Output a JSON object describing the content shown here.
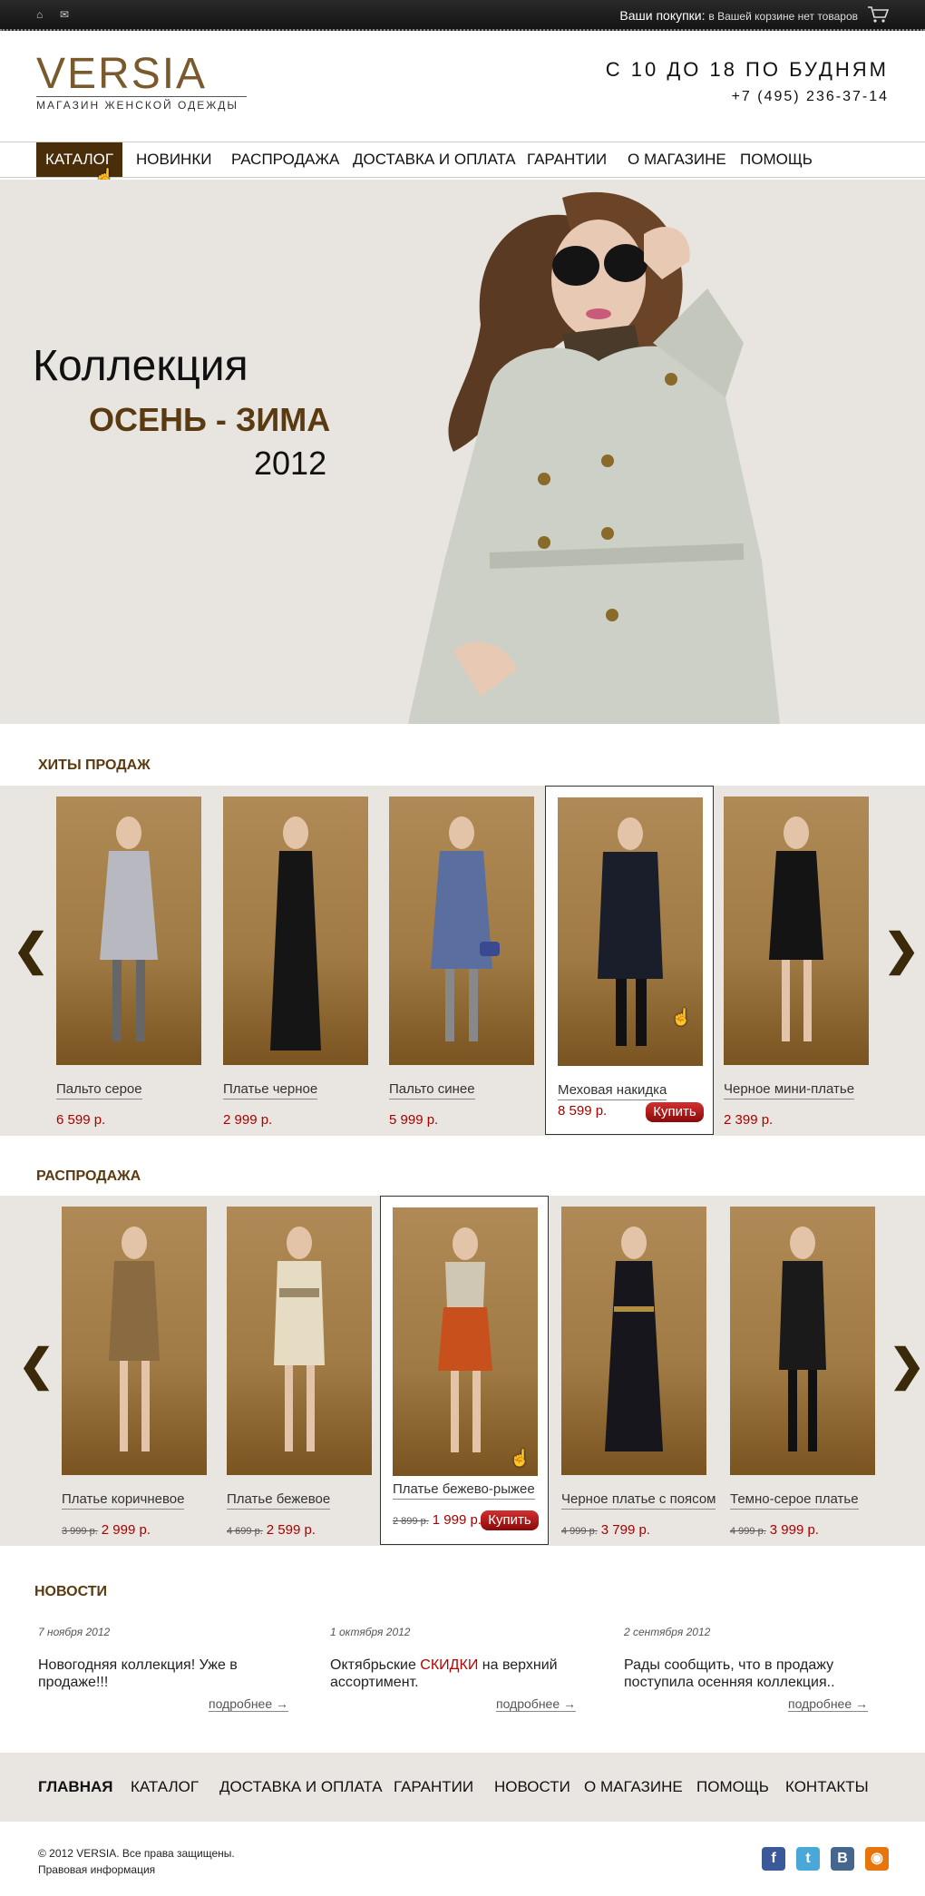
{
  "topbar": {
    "cart_label": "Ваши покупки:",
    "cart_status": "в Вашей корзине нет товаров",
    "icons": [
      "home-icon",
      "mail-icon",
      "cart-icon"
    ]
  },
  "header": {
    "logo": "VERSIA",
    "logo_sub": "МАГАЗИН ЖЕНСКОЙ ОДЕЖДЫ",
    "hours": "С 10 ДО 18 ПО БУДНЯМ",
    "phone": "+7 (495) 236-37-14"
  },
  "nav": {
    "items": [
      {
        "label": "КАТАЛОГ",
        "active": true
      },
      {
        "label": "НОВИНКИ"
      },
      {
        "label": "РАСПРОДАЖА"
      },
      {
        "label": "ДОСТАВКА И ОПЛАТА"
      },
      {
        "label": "ГАРАНТИИ"
      },
      {
        "label": "О МАГАЗИНЕ"
      },
      {
        "label": "ПОМОЩЬ"
      }
    ],
    "active_color": "#4a2e0a"
  },
  "hero": {
    "line1": "Коллекция",
    "line2": "ОСЕНЬ - ЗИМА",
    "line3": "2012"
  },
  "hits": {
    "title": "ХИТЫ ПРОДАЖ",
    "prev": "❮",
    "next": "❯",
    "items": [
      {
        "name": "Пальто серое",
        "price": "6 599 р."
      },
      {
        "name": "Платье черное",
        "price": "2 999 р."
      },
      {
        "name": "Пальто синее",
        "price": "5 999 р."
      },
      {
        "name": "Меховая накидка",
        "price": "8 599 р.",
        "buy": "Купить",
        "highlighted": true
      },
      {
        "name": "Черное мини-платье",
        "price": "2 399 р."
      }
    ]
  },
  "sale": {
    "title": "РАСПРОДАЖА",
    "prev": "❮",
    "next": "❯",
    "items": [
      {
        "name": "Платье коричневое",
        "old_price": "3 999 р.",
        "price": "2 999 р."
      },
      {
        "name": "Платье бежевое",
        "old_price": "4 699 р.",
        "price": "2 599 р."
      },
      {
        "name": "Платье бежево-рыжее",
        "old_price": "2 899 р.",
        "price": "1 999 р.",
        "buy": "Купить",
        "highlighted": true
      },
      {
        "name": "Черное платье с поясом",
        "old_price": "4 999 р.",
        "price": "3 799 р."
      },
      {
        "name": "Темно-серое платье",
        "old_price": "4 999 р.",
        "price": "3 999 р."
      }
    ]
  },
  "news": {
    "title": "НОВОСТИ",
    "more_label": "подробнее →",
    "items": [
      {
        "date": "7 ноября 2012",
        "text": "Новогодняя коллекция! Уже в продаже!!!"
      },
      {
        "date": "1 октября 2012",
        "text_before": "Октябрьские ",
        "text_red": "СКИДКИ",
        "text_after": " на верхний ассортимент."
      },
      {
        "date": "2 сентября 2012",
        "text": "Рады сообщить, что в продажу поступила осенняя коллекция.."
      }
    ]
  },
  "footer": {
    "nav": [
      "ГЛАВНАЯ",
      "КАТАЛОГ",
      "ДОСТАВКА И ОПЛАТА",
      "ГАРАНТИИ",
      "НОВОСТИ",
      "О МАГАЗИНЕ",
      "ПОМОЩЬ",
      "КОНТАКТЫ"
    ],
    "copyright": "© 2012 VERSIA. Все права защищены.",
    "legal": "Правовая информация",
    "social": [
      {
        "icon": "facebook-icon",
        "glyph": "f",
        "color": "#3b5998"
      },
      {
        "icon": "twitter-icon",
        "glyph": "t",
        "color": "#4aa8d8"
      },
      {
        "icon": "vkontakte-icon",
        "glyph": "B",
        "color": "#45668e"
      },
      {
        "icon": "rss-icon",
        "glyph": "◉",
        "color": "#e8740c"
      }
    ]
  }
}
